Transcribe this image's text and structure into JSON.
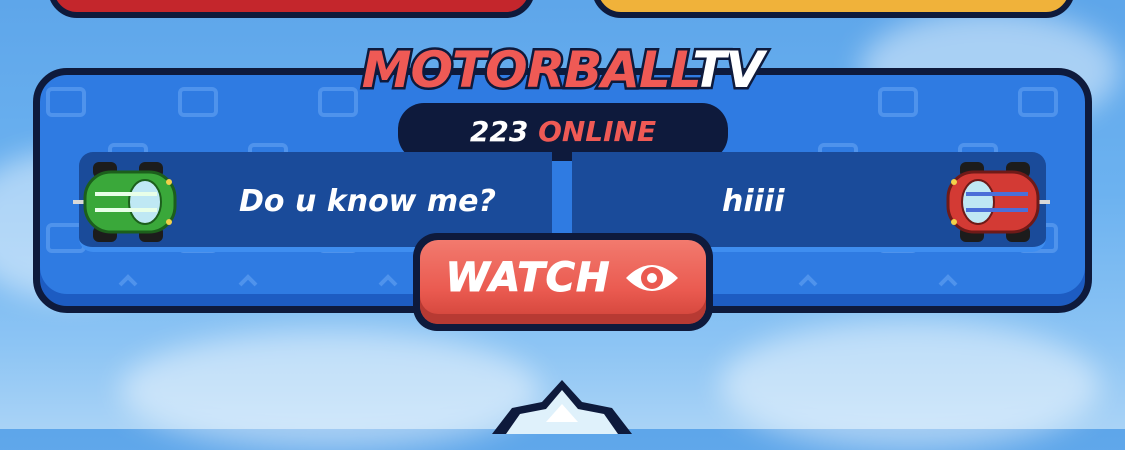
{
  "top_buttons": [
    {
      "color": "#c4262c"
    },
    {
      "color": "#f0b23a"
    }
  ],
  "header": {
    "title_part1": "MOTORBALL",
    "title_part2": "TV"
  },
  "online": {
    "count": "223",
    "label": "ONLINE"
  },
  "match": {
    "left_player": {
      "name": "Do u know me?",
      "car_color": "green",
      "car_icon": "green-car-icon"
    },
    "right_player": {
      "name": "hiiii",
      "car_color": "red",
      "car_icon": "red-car-icon"
    }
  },
  "watch_button": {
    "label": "WATCH",
    "icon": "eye-icon"
  },
  "colors": {
    "accent_red": "#ef5a55",
    "outline": "#0e1a3c",
    "panel_blue": "#2f7be2"
  }
}
